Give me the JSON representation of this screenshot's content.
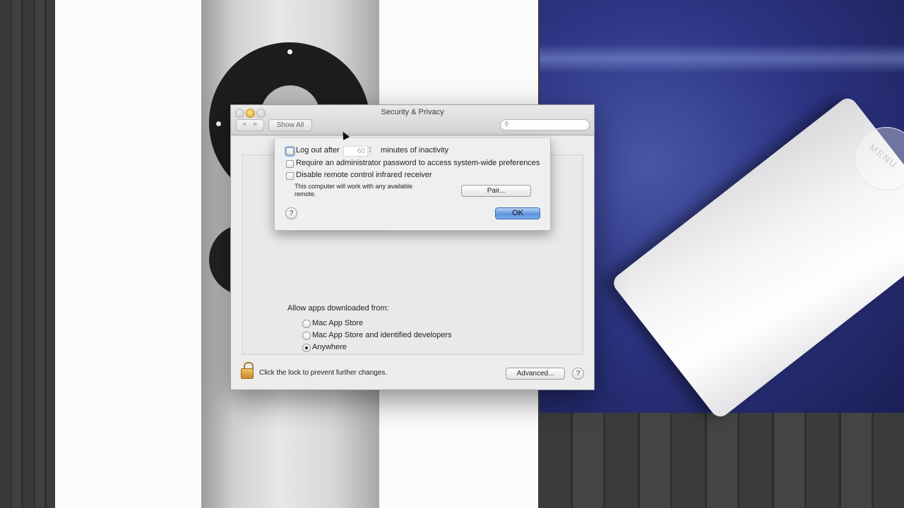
{
  "window": {
    "title": "Security & Privacy",
    "show_all_label": "Show All",
    "search_placeholder": "",
    "back_arrow": "◀",
    "forward_arrow": "▶"
  },
  "sheet": {
    "logout_label": "Log out after",
    "logout_minutes": "60",
    "logout_suffix": "minutes of inactivity",
    "admin_password_label": "Require an administrator password to access system-wide preferences",
    "disable_remote_label": "Disable remote control infrared receiver",
    "remote_note": "This computer will work with any available remote.",
    "pair_button": "Pair...",
    "ok_button": "OK",
    "help_glyph": "?"
  },
  "downloads": {
    "heading": "Allow apps downloaded from:",
    "options": [
      {
        "label": "Mac App Store",
        "selected": false
      },
      {
        "label": "Mac App Store and identified developers",
        "selected": false
      },
      {
        "label": "Anywhere",
        "selected": true
      }
    ]
  },
  "footer": {
    "lock_text": "Click the lock to prevent further changes.",
    "advanced_button": "Advanced...",
    "help_glyph": "?"
  },
  "background": {
    "remote_label": "MENU"
  },
  "colors": {
    "accent_blue": "#5e93de",
    "cloth_blue": "#2d3585",
    "wood_grey": "#3b3b3b"
  }
}
